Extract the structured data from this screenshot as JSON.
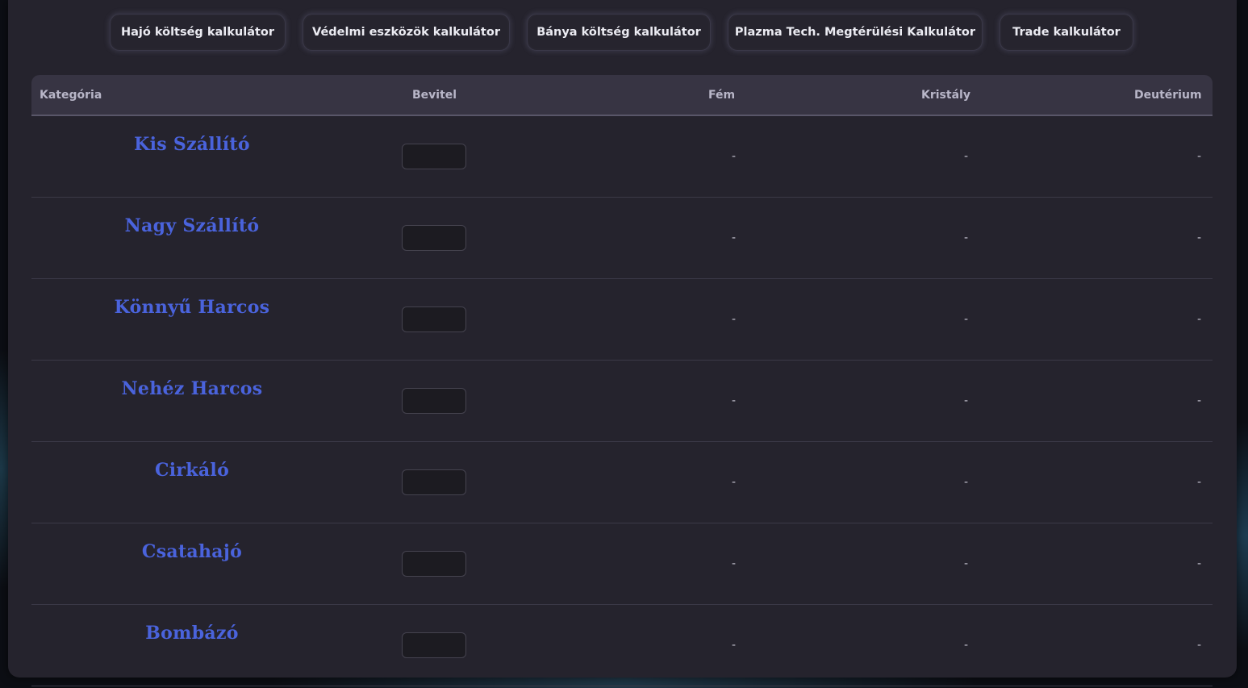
{
  "nav": {
    "buttons": [
      {
        "label": "Hajó költség kalkulátor"
      },
      {
        "label": "Védelmi eszközök kalkulátor"
      },
      {
        "label": "Bánya költség kalkulátor"
      },
      {
        "label": "Plazma Tech. Megtérülési Kalkulátor"
      },
      {
        "label": "Trade kalkulátor"
      }
    ]
  },
  "table": {
    "headers": {
      "category": "Kategória",
      "input": "Bevitel",
      "metal": "Fém",
      "crystal": "Kristály",
      "deuterium": "Deutérium"
    },
    "rows": [
      {
        "name": "Kis Szállító",
        "input": "",
        "metal": "-",
        "crystal": "-",
        "deuterium": "-"
      },
      {
        "name": "Nagy Szállító",
        "input": "",
        "metal": "-",
        "crystal": "-",
        "deuterium": "-"
      },
      {
        "name": "Könnyű Harcos",
        "input": "",
        "metal": "-",
        "crystal": "-",
        "deuterium": "-"
      },
      {
        "name": "Nehéz Harcos",
        "input": "",
        "metal": "-",
        "crystal": "-",
        "deuterium": "-"
      },
      {
        "name": "Cirkáló",
        "input": "",
        "metal": "-",
        "crystal": "-",
        "deuterium": "-"
      },
      {
        "name": "Csatahajó",
        "input": "",
        "metal": "-",
        "crystal": "-",
        "deuterium": "-"
      },
      {
        "name": "Bombázó",
        "input": "",
        "metal": "-",
        "crystal": "-",
        "deuterium": "-"
      }
    ]
  },
  "colors": {
    "category_text": "#4a63dc",
    "panel_bg": "#25232d",
    "header_bg": "#373443"
  }
}
